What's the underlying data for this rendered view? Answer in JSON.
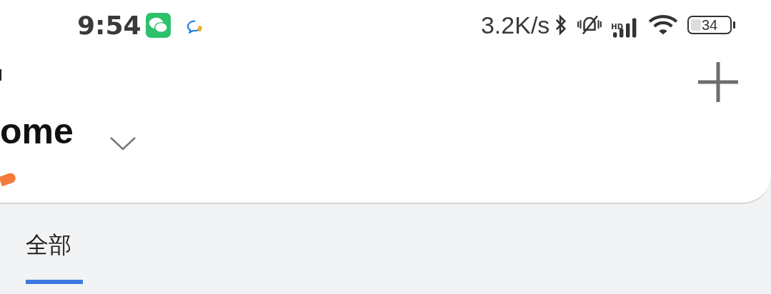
{
  "status_bar": {
    "time": "9:54",
    "speed": "3.2K/s",
    "signal_label": "HD",
    "battery": "34"
  },
  "header": {
    "title": "ome"
  },
  "tabs": [
    {
      "label": "全部",
      "selected": true
    }
  ]
}
